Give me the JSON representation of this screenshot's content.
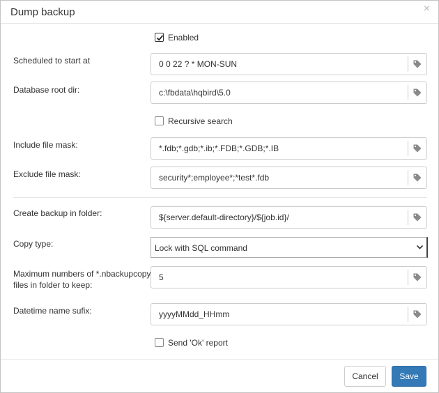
{
  "dialog": {
    "title": "Dump backup"
  },
  "form": {
    "enabled_label": "Enabled",
    "enabled_checked": true,
    "schedule": {
      "label": "Scheduled to start at",
      "value": "0 0 22 ? * MON-SUN"
    },
    "db_root": {
      "label": "Database root dir:",
      "value": "c:\\fbdata\\hqbird\\5.0"
    },
    "recursive_label": "Recursive search",
    "recursive_checked": false,
    "include_mask": {
      "label": "Include file mask:",
      "value": "*.fdb;*.gdb;*.ib;*.FDB;*.GDB;*.IB"
    },
    "exclude_mask": {
      "label": "Exclude file mask:",
      "value": "security*;employee*;*test*.fdb"
    },
    "backup_folder": {
      "label": "Create backup in folder:",
      "value": "${server.default-directory}/${job.id}/"
    },
    "copy_type": {
      "label": "Copy type:",
      "value": "Lock with SQL command"
    },
    "max_files": {
      "label_line1": "Maximum numbers of *.nbackupcopy",
      "label_line2": "files in folder to keep:",
      "value": "5"
    },
    "datetime_suffix": {
      "label": "Datetime name sufix:",
      "value": "yyyyMMdd_HHmm"
    },
    "send_ok_label": "Send 'Ok' report",
    "send_ok_checked": false
  },
  "footer": {
    "cancel_label": "Cancel",
    "save_label": "Save"
  },
  "icons": {
    "field_addon": "tag-icon",
    "select_arrow": "chevron-down-icon",
    "close": "close-icon"
  },
  "colors": {
    "primary": "#337ab7",
    "border": "#cccccc"
  }
}
